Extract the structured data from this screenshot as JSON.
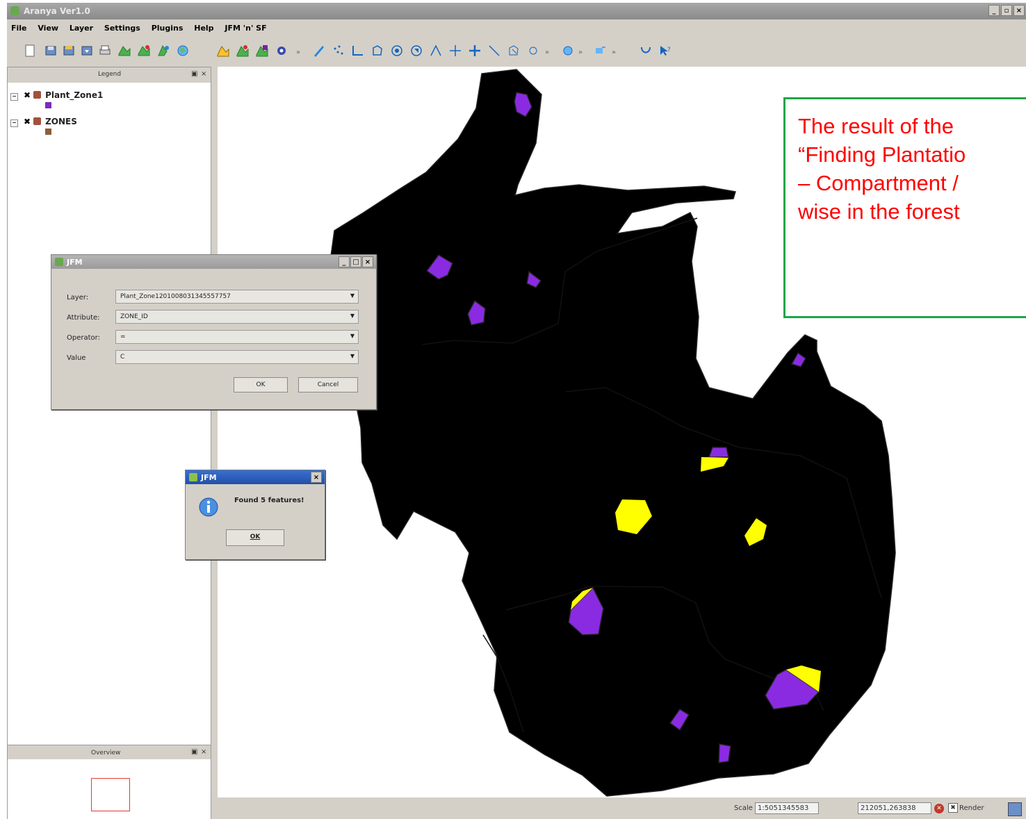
{
  "window": {
    "title": "Aranya Ver1.0"
  },
  "menu": [
    "File",
    "View",
    "Layer",
    "Settings",
    "Plugins",
    "Help",
    "JFM 'n' SF"
  ],
  "legend": {
    "title": "Legend",
    "layers": [
      {
        "name": "Plant_Zone1",
        "swatch_color": "#7b2cbf"
      },
      {
        "name": "ZONES",
        "swatch_color": "#8b5e3c"
      }
    ]
  },
  "overview": {
    "title": "Overview"
  },
  "query_dialog": {
    "title": "JFM",
    "fields": [
      {
        "label": "Layer:",
        "value": "Plant_Zone1201008031345557757"
      },
      {
        "label": "Attribute:",
        "value": "ZONE_ID"
      },
      {
        "label": "Operator:",
        "value": "="
      },
      {
        "label": "Value",
        "value": "C"
      }
    ],
    "ok_label": "OK",
    "cancel_label": "Cancel"
  },
  "message_box": {
    "title": "JFM",
    "message": "Found 5 features!",
    "ok_label": "OK"
  },
  "annotation": {
    "lines": [
      "The result of the",
      "“Finding Plantatio",
      "– Compartment /",
      "wise in the forest"
    ]
  },
  "statusbar": {
    "scale_label": "Scale",
    "scale_value": "1:5051345583",
    "coordinates": "212051,263838",
    "render_label": "Render"
  },
  "colors": {
    "land": "#8b6d4d",
    "plantation": "#8a2be2",
    "selected": "#ffff00",
    "annotation_text": "#ff0000",
    "annotation_border": "#1aa64a"
  }
}
